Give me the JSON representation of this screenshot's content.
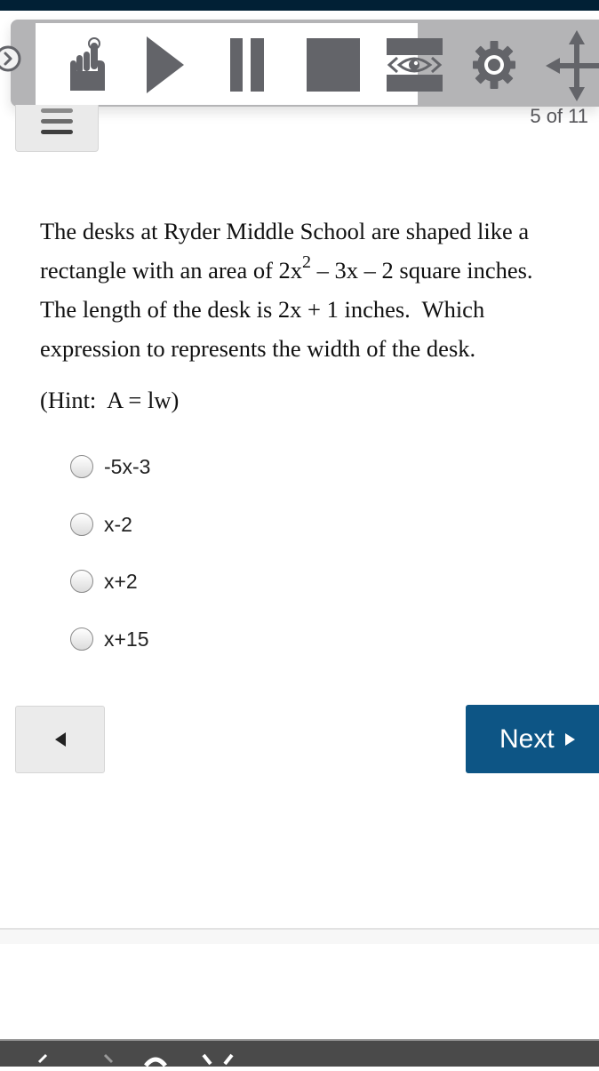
{
  "toolbar": {
    "tools": [
      {
        "name": "pointer",
        "icon": "pointer-hand-icon"
      },
      {
        "name": "play",
        "icon": "play-icon"
      },
      {
        "name": "pause",
        "icon": "pause-icon"
      },
      {
        "name": "stop",
        "icon": "stop-icon"
      },
      {
        "name": "mask",
        "icon": "eye-mask-icon"
      },
      {
        "name": "settings",
        "icon": "gear-icon"
      },
      {
        "name": "move",
        "icon": "move-arrows-icon"
      }
    ],
    "expand_icon": "chevron-right-circle-icon",
    "menu_icon": "hamburger-menu-icon",
    "colors": {
      "icon": "#636469",
      "panel": "#b4b4b6"
    }
  },
  "page_counter": "5 of 11",
  "question": {
    "line1": "The desks at Ryder Middle School are shaped like a",
    "line2_pre": "rectangle with an area of 2x",
    "line2_exp": "2",
    "line2_post": " – 3x – 2 square inches.",
    "line3": "The length of the desk is 2x + 1 inches.  Which",
    "line4": "expression to represents the width of the desk.",
    "hint": "(Hint:  A = lw)"
  },
  "choices": [
    {
      "label": "-5x-3",
      "selected": false
    },
    {
      "label": "x-2",
      "selected": false
    },
    {
      "label": "x+2",
      "selected": false
    },
    {
      "label": "x+15",
      "selected": false
    }
  ],
  "navigation": {
    "prev_icon": "triangle-left-icon",
    "next_label": "Next",
    "next_icon": "triangle-right-icon",
    "next_color": "#0d5585"
  }
}
